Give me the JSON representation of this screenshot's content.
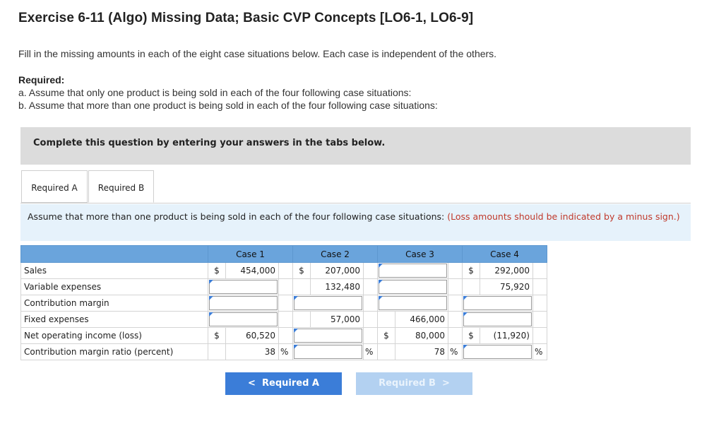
{
  "page": {
    "title": "Exercise 6-11 (Algo) Missing Data; Basic CVP Concepts [LO6-1, LO6-9]",
    "instructions": "Fill in the missing amounts in each of the eight case situations below. Each case is independent of the others.",
    "required_heading": "Required:",
    "required_a": "a. Assume that only one product is being sold in each of the four following case situations:",
    "required_b": "b. Assume that more than one product is being sold in each of the four following case situations:"
  },
  "banner": {
    "text": "Complete this question by entering your answers in the tabs below."
  },
  "tabs": [
    {
      "label": "Required A"
    },
    {
      "label": "Required B"
    }
  ],
  "panel": {
    "text": "Assume that more than one product is being sold in each of the four following case situations: ",
    "note": "(Loss amounts should be indicated by a minus sign.)"
  },
  "table": {
    "headers": [
      "Case 1",
      "Case 2",
      "Case 3",
      "Case 4"
    ],
    "row_labels": {
      "sales": "Sales",
      "variable_expenses": "Variable expenses",
      "contribution_margin": "Contribution margin",
      "fixed_expenses": "Fixed expenses",
      "net_operating_income": "Net operating income (loss)",
      "cm_ratio": "Contribution margin ratio (percent)"
    },
    "currency": "$",
    "percent": "%",
    "case1": {
      "sales": "454,000",
      "net_operating_income": "60,520",
      "cm_ratio": "38"
    },
    "case2": {
      "sales": "207,000",
      "variable_expenses": "132,480",
      "fixed_expenses": "57,000"
    },
    "case3": {
      "fixed_expenses": "466,000",
      "net_operating_income": "80,000",
      "cm_ratio": "78"
    },
    "case4": {
      "sales": "292,000",
      "variable_expenses": "75,920",
      "net_operating_income": "(11,920)"
    }
  },
  "nav": {
    "prev_label": "Required A",
    "next_label": "Required B",
    "prev_glyph": "<",
    "next_glyph": ">"
  },
  "colors": {
    "accent": "#3b7dd8",
    "header": "#6aa4dc",
    "panel": "#e6f2fb",
    "note": "#c0392b"
  }
}
